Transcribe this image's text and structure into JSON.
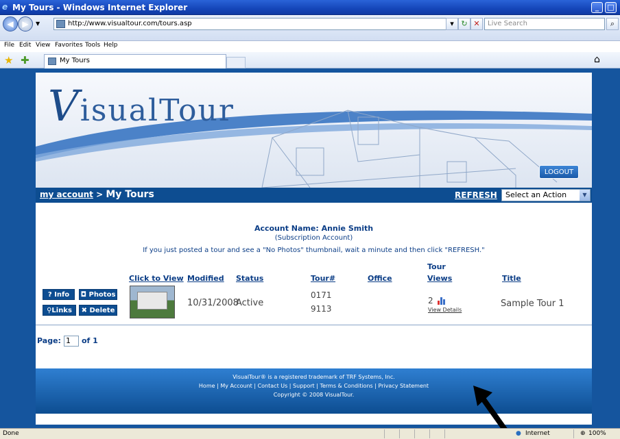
{
  "window": {
    "title": "My Tours - Windows Internet Explorer",
    "url": "http://www.visualtour.com/tours.asp",
    "search_placeholder": "Live Search",
    "menu": [
      "File",
      "Edit",
      "View",
      "Favorites",
      "Tools",
      "Help"
    ],
    "tab_title": "My Tours"
  },
  "site": {
    "logo_letter": "V",
    "logo_rest": "isualTour",
    "logout_label": "LOGOUT",
    "breadcrumb_link": "my account",
    "breadcrumb_sep": " > ",
    "breadcrumb_current": "My Tours",
    "refresh_label": "REFRESH",
    "action_select": "Select an Action",
    "account_name": "Account Name: Annie Smith",
    "account_type": "(Subscription Account)",
    "hint": "If you just posted a tour and see a \"No Photos\" thumbnail, wait a minute and then click \"REFRESH.\""
  },
  "table": {
    "headers": {
      "click_to_view": "Click to View",
      "modified": "Modified",
      "status": "Status",
      "tour_no": "Tour#",
      "office": "Office",
      "tour_views_1": "Tour",
      "tour_views_2": "Views",
      "title": "Title"
    },
    "buttons": {
      "info": "Info",
      "photos": "Photos",
      "links": "Links",
      "delete": "Delete"
    },
    "row": {
      "modified": "10/31/2008",
      "status": "Active",
      "tour_line1": "0171",
      "tour_line2": "9113",
      "views": "2",
      "view_details": "View Details",
      "title": "Sample Tour 1"
    }
  },
  "pager": {
    "label": "Page:",
    "current": "1",
    "of": "of 1"
  },
  "footer": {
    "line1": "VisualTour® is a registered trademark of TRF Systems, Inc.",
    "line2": "Home | My Account | Contact Us | Support | Terms & Conditions | Privacy Statement",
    "line3": "Copyright © 2008 VisualTour."
  },
  "statusbar": {
    "left": "Done",
    "zone": "Internet",
    "zoom": "100%"
  }
}
